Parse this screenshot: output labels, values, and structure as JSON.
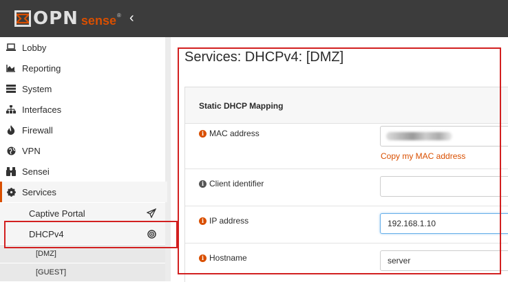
{
  "brand": {
    "logo_text": "OPN",
    "logo_suffix": "sense",
    "logo_registered": "®",
    "accent_color": "#d94f00",
    "topbar_color": "#3c3c3c"
  },
  "topbar": {
    "collapse_icon": "‹"
  },
  "sidebar": {
    "items": [
      {
        "label": "Lobby",
        "icon": "laptop-icon"
      },
      {
        "label": "Reporting",
        "icon": "area-chart-icon"
      },
      {
        "label": "System",
        "icon": "server-icon"
      },
      {
        "label": "Interfaces",
        "icon": "sitemap-icon"
      },
      {
        "label": "Firewall",
        "icon": "fire-icon"
      },
      {
        "label": "VPN",
        "icon": "globe-icon"
      },
      {
        "label": "Sensei",
        "icon": "binoculars-icon"
      },
      {
        "label": "Services",
        "icon": "cog-icon"
      }
    ],
    "services_children": [
      {
        "label": "Captive Portal",
        "icon": "paper-plane-icon"
      },
      {
        "label": "DHCPv4",
        "icon": "bullseye-icon"
      }
    ],
    "dhcp_children": [
      {
        "label": "[DMZ]"
      },
      {
        "label": "[GUEST]"
      }
    ]
  },
  "page": {
    "title": "Services: DHCPv4: [DMZ]"
  },
  "form": {
    "section_title": "Static DHCP Mapping",
    "fields": [
      {
        "label": "MAC address",
        "info_color": "orange",
        "value": ""
      },
      {
        "label": "Client identifier",
        "info_color": "grey",
        "value": ""
      },
      {
        "label": "IP address",
        "info_color": "orange",
        "value": "192.168.1.10"
      },
      {
        "label": "Hostname",
        "info_color": "orange",
        "value": "server"
      }
    ],
    "copy_mac_link": "Copy my MAC address"
  },
  "annotations": {
    "highlight_color": "#d21f1f"
  }
}
